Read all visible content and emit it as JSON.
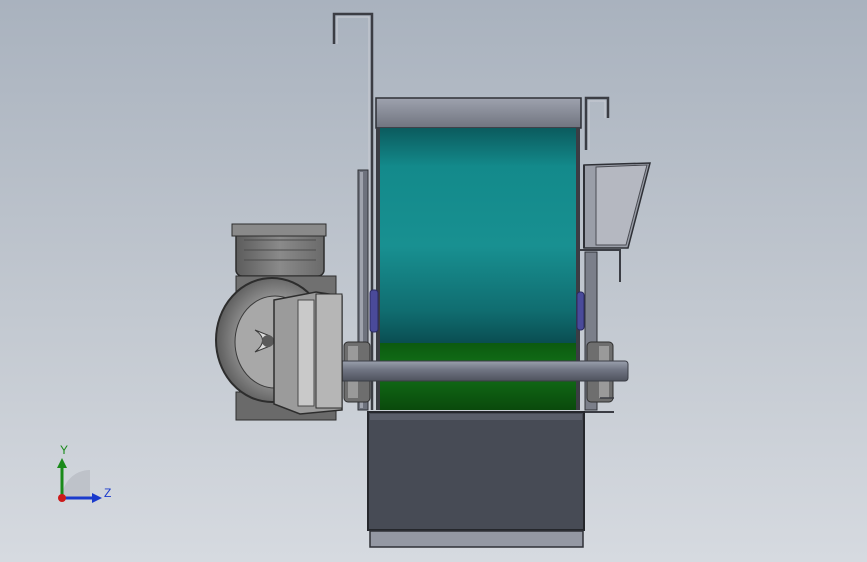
{
  "colors": {
    "background_top": "#a9b2be",
    "background_bottom": "#d6dae0",
    "drum_teal": "#168c8c",
    "drum_green": "#0e6b12",
    "hopper_dark": "#474b55",
    "frame_gray": "#8e93a0",
    "motor_gray": "#808080",
    "shaft_gray": "#7d8190",
    "bearing_blue": "#4a4a9a",
    "axis_y": "#1a8a1a",
    "axis_z": "#1a3acc",
    "axis_origin": "#cc1a1a"
  },
  "triad": {
    "y_label": "Y",
    "z_label": "Z"
  }
}
